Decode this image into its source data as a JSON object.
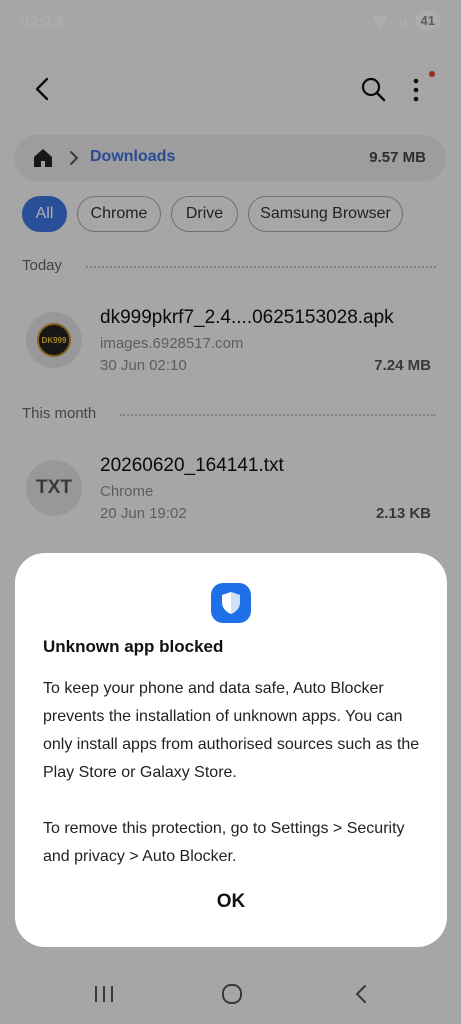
{
  "status": {
    "time": "02:13",
    "battery": "41"
  },
  "header": {
    "back_icon": "back-arrow-icon",
    "search_icon": "search-icon",
    "more_icon": "more-vertical-icon"
  },
  "breadcrumb": {
    "location": "Downloads",
    "total_size": "9.57 MB"
  },
  "filters": [
    "All",
    "Chrome",
    "Drive",
    "Samsung Browser"
  ],
  "sections": {
    "today": "Today",
    "this_month": "This month"
  },
  "files": [
    {
      "name": "dk999pkrf7_2.4....0625153028.apk",
      "source": "images.6928517.com",
      "date": "30 Jun 02:10",
      "size": "7.24 MB",
      "thumb": "DK999"
    },
    {
      "name": "20260620_164141.txt",
      "source": "Chrome",
      "date": "20 Jun 19:02",
      "size": "2.13 KB",
      "thumb": "TXT"
    }
  ],
  "dialog": {
    "title": "Unknown app blocked",
    "body": "To keep your phone and data safe, Auto Blocker prevents the installation of unknown apps. You can only install apps from authorised sources such as the Play Store or Galaxy Store.\n\nTo remove this protection, go to Settings > Security and privacy > Auto Blocker.",
    "ok_label": "OK"
  },
  "colors": {
    "accent": "#3b75e0",
    "shield": "#1f6fe8",
    "notification_dot": "#e8402f"
  }
}
